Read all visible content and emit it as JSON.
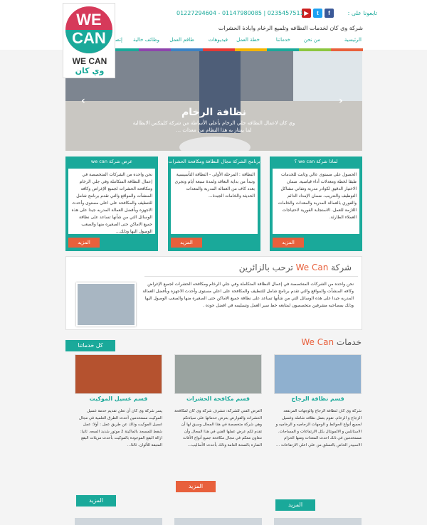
{
  "logo": {
    "top_text": "WE",
    "bottom_text": "CAN",
    "word": "WE CAN",
    "arabic": "وي كان"
  },
  "header": {
    "follow_label": "تابعونا على :",
    "social": [
      {
        "name": "facebook",
        "glyph": "f",
        "color": "#3b5998"
      },
      {
        "name": "twitter",
        "glyph": "t",
        "color": "#1da1f2"
      },
      {
        "name": "youtube",
        "glyph": "▶",
        "color": "#cc2020"
      }
    ],
    "phones": "01227294604 - 01147980085  |  0235457511",
    "tagline": "شركة وى كان لخدمات النظافه وتلميع الرخام وابادة الحشرات"
  },
  "nav": [
    "الرئيسية",
    "من نحن",
    "خدماتنا",
    "خطة العمل",
    "فيديوهات",
    "طاقم العمل",
    "وظائف خالية",
    "إتصل"
  ],
  "stripe_colors": [
    "#e8603c",
    "#8cc63f",
    "#1aa99a",
    "#f4b400",
    "#e53935",
    "#3b82c4",
    "#8e44ad",
    "#1aa99a"
  ],
  "slider": {
    "title": "نظافة الرخام",
    "text_line1": "وي كان لاعمال النظافه جلي الرخام بأعلى الأساطة من شركة كليتكس الايطالية",
    "text_line2": "لما يمتاز به هذا النظام من معدات ..."
  },
  "boxes": [
    {
      "heading": "لماذا شركة we can ؟",
      "text": "الحصول على مستوى عالي وثابت للخدمات طبقا لخطة ومعدلات أداء قياسية. ضمان الاختيار الدقيق لكوادر مدربة وتفاني مشاكل التوظيف والتدريب. ضمان الإمداد الدائم والفوري بالعمالة المدربة والمعدات والخامات اللازمة للعمل. الاستجابة الفورية لاحتياجات العملاء الطارئة.",
      "more": "المزيد"
    },
    {
      "heading": "برنامج الشركة مجال النظافة ومكافحة الحشرات",
      "text": "النظافة : المرحلة الأولى - النظافة التأسيسية وتبدأ من بداية التعاقد ولمدة سبعة أيام وتجرى بعدد كاف من العمالة المدربة والمعدات الحديثة والخامات الجيدة...",
      "more": "المزيد"
    },
    {
      "heading": "عرض شركة we can",
      "text": "نحن واحده من الشركات المتخصصة في إعمال النظافة المتكاملة وفي جلي الرخام ومكافحه الحشرات لجميع الإغراض وكافه المنشآت والمواقع والتي تقدم برنامج شامل للتنظيف والمكافحة على اعلى مستوى وأحدث الاجهزه وبأفضل العمالة المدربه جيدا على هذه الوسائل التي من شأنها تساعد على نظافة جميع الاماكن حتى الصغيره منها والصعب الوصول اليها وذلك...",
      "more": "المزيد"
    }
  ],
  "welcome": {
    "title_prefix": "شركة",
    "title_brand": "We Can",
    "title_suffix": "ترحب بالزائرين",
    "text": "نحن واحده من الشركات المتخصصة في إعمال النظافة المتكاملة وفي جلي الرخام ومكافحه الحشرات لجميع الإغراض وكافه المنشآت والمواقع والتي تقدم برنامج شامل للتنظيف والمكافحة على اعلي مستوى وأحدث الاجهزه وبأفضل العمالة المدربه جيدا على هذه الوسائل التي من شأنها تساعد على نظافة جميع الاماكن حتى الصغيره منها والصعب الوصول اليها وذلك بمصاحبه مشرفين متخصصون لمتابعه خط سير العمل وتسليمه في افضل حوده ."
  },
  "services_section": {
    "title_prefix": "خدمات",
    "title_brand": "We Can",
    "all_label": "كل خدماتنا"
  },
  "services": [
    {
      "name": "قسم نظافة الزجاج",
      "text": "شركة وى كان لنظافة الزجاج والوجهات المرتفعه الزجاج و الرخام. نقوم بعمل نظافه شامله وغسيل لجميع أنواع الحوائط و الوجهات الزجاجيه و الرخاميه و الاستانلس و الالمونتال بكل الارتفاعات و المساحات. مستخدمين في ذلك احدث المعدات ومنها الحزام الاسبيدر الخاص بالتسلق من علي اعلي الارتفاعات ...",
      "more": "المزيد",
      "more_color": "#1aa99a",
      "img_color": "#8fb0cf"
    },
    {
      "name": "قسم مكافحة الحشرات",
      "text": "العرض الفني للشركة: تتشرف شركة وى كان لمكافحة الحشرات والقوارض بعرض خدماتها على سيادتكم وهي شركة متخصصة في هذا المجال وسبق لها أن تقدم لكم عرض عملها الفني في هذا المجال وأن نتعاون معكم في مجال مكافحة جميع أنواع الأفات الضارة بالصحة العامة وذلك بأحدث الأساليب...",
      "more": "المزيد",
      "more_color": "#e8603c",
      "img_color": "#9aa3a0"
    },
    {
      "name": "قسم غسيل الموكيت",
      "text": "يسر شركة وى كان أن تعلن تقديم خدمة غسيل الموكيت مستخدمين أحدث الطرق العلمية في مجال غسيل الموكيت وذلك عن طريق عمل : أولا: عمل شفط للمسجد بالماكينة 2 موتور شديد السعه. ثانيا: ازالة البقع الموجودة بالموكيت بأحدث مزيلات البقع المتبقة للألوان. ثالثا...",
      "more": "المزيد",
      "more_color": "#1aa99a",
      "img_color": "#b5522f"
    }
  ]
}
